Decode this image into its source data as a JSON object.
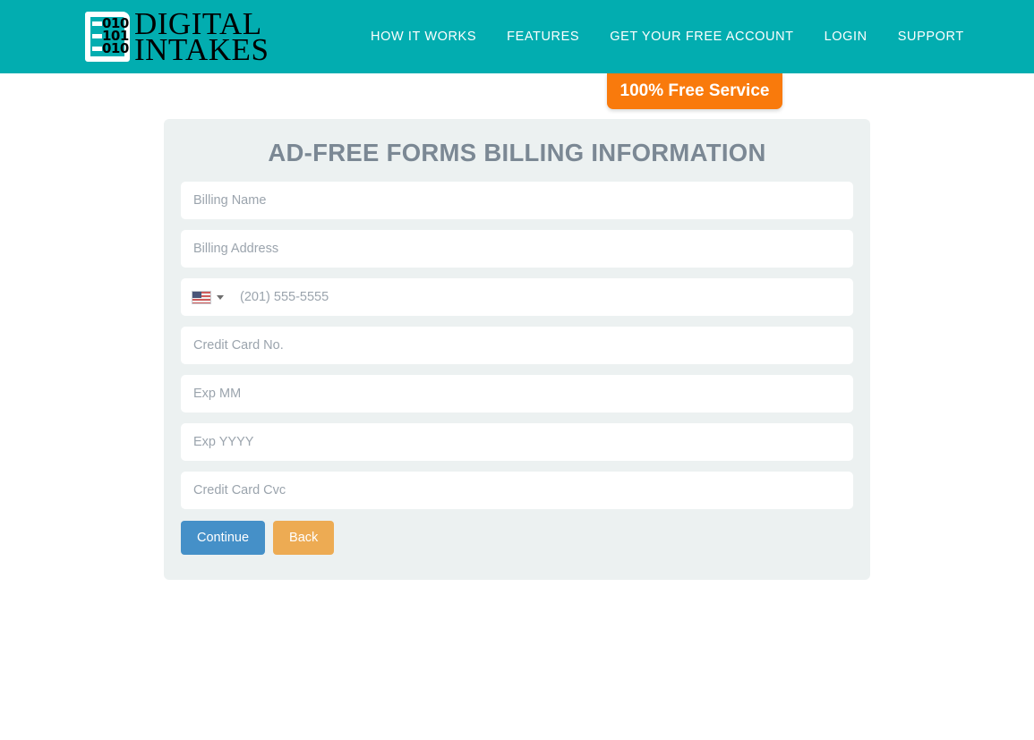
{
  "header": {
    "brand": {
      "icon_name": "document-binary-logo-icon",
      "binary_lines": [
        "010",
        "101",
        "010"
      ],
      "name_line1": "DIGITAL",
      "name_line2": "INTAKES"
    },
    "nav": [
      {
        "label": "HOW IT WORKS"
      },
      {
        "label": "FEATURES"
      },
      {
        "label": "GET YOUR FREE ACCOUNT"
      },
      {
        "label": "LOGIN"
      },
      {
        "label": "SUPPORT"
      }
    ],
    "background_color": "#02adb0"
  },
  "badge": {
    "label": "100% Free Service",
    "background_color": "#f97a0c",
    "text_color": "#ffffff"
  },
  "card": {
    "title": "AD-FREE FORMS BILLING INFORMATION",
    "title_color": "#7b8894",
    "background_color": "#ecf1f1"
  },
  "form": {
    "fields": [
      {
        "name": "billing-name",
        "placeholder": "Billing Name",
        "value": ""
      },
      {
        "name": "billing-address",
        "placeholder": "Billing Address",
        "value": ""
      },
      {
        "name": "credit-card-no",
        "placeholder": "Credit Card No.",
        "value": ""
      },
      {
        "name": "exp-mm",
        "placeholder": "Exp MM",
        "value": ""
      },
      {
        "name": "exp-yyyy",
        "placeholder": "Exp YYYY",
        "value": ""
      },
      {
        "name": "credit-card-cvc",
        "placeholder": "Credit Card Cvc",
        "value": ""
      }
    ],
    "phone": {
      "country_flag": "us-flag-icon",
      "country": "United States",
      "dropdown_icon": "chevron-down-icon",
      "placeholder": "(201) 555-5555",
      "value": ""
    },
    "buttons": {
      "continue": {
        "label": "Continue",
        "color": "#4590c8"
      },
      "back": {
        "label": "Back",
        "color": "#edab53"
      }
    }
  }
}
